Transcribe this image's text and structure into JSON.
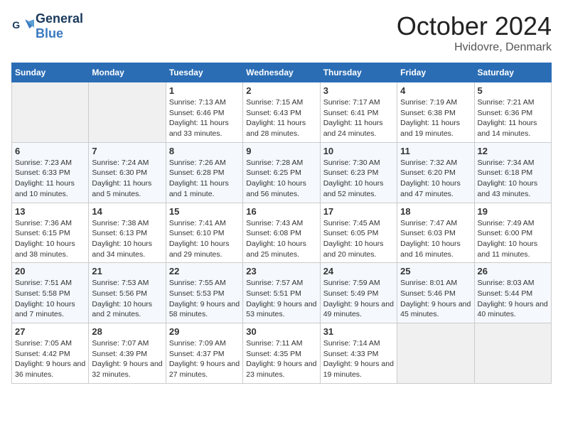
{
  "header": {
    "logo_text_general": "General",
    "logo_text_blue": "Blue",
    "month_title": "October 2024",
    "location": "Hvidovre, Denmark"
  },
  "columns": [
    "Sunday",
    "Monday",
    "Tuesday",
    "Wednesday",
    "Thursday",
    "Friday",
    "Saturday"
  ],
  "weeks": [
    [
      {
        "day": "",
        "info": ""
      },
      {
        "day": "",
        "info": ""
      },
      {
        "day": "1",
        "sunrise": "7:13 AM",
        "sunset": "6:46 PM",
        "daylight": "11 hours and 33 minutes."
      },
      {
        "day": "2",
        "sunrise": "7:15 AM",
        "sunset": "6:43 PM",
        "daylight": "11 hours and 28 minutes."
      },
      {
        "day": "3",
        "sunrise": "7:17 AM",
        "sunset": "6:41 PM",
        "daylight": "11 hours and 24 minutes."
      },
      {
        "day": "4",
        "sunrise": "7:19 AM",
        "sunset": "6:38 PM",
        "daylight": "11 hours and 19 minutes."
      },
      {
        "day": "5",
        "sunrise": "7:21 AM",
        "sunset": "6:36 PM",
        "daylight": "11 hours and 14 minutes."
      }
    ],
    [
      {
        "day": "6",
        "sunrise": "7:23 AM",
        "sunset": "6:33 PM",
        "daylight": "11 hours and 10 minutes."
      },
      {
        "day": "7",
        "sunrise": "7:24 AM",
        "sunset": "6:30 PM",
        "daylight": "11 hours and 5 minutes."
      },
      {
        "day": "8",
        "sunrise": "7:26 AM",
        "sunset": "6:28 PM",
        "daylight": "11 hours and 1 minute."
      },
      {
        "day": "9",
        "sunrise": "7:28 AM",
        "sunset": "6:25 PM",
        "daylight": "10 hours and 56 minutes."
      },
      {
        "day": "10",
        "sunrise": "7:30 AM",
        "sunset": "6:23 PM",
        "daylight": "10 hours and 52 minutes."
      },
      {
        "day": "11",
        "sunrise": "7:32 AM",
        "sunset": "6:20 PM",
        "daylight": "10 hours and 47 minutes."
      },
      {
        "day": "12",
        "sunrise": "7:34 AM",
        "sunset": "6:18 PM",
        "daylight": "10 hours and 43 minutes."
      }
    ],
    [
      {
        "day": "13",
        "sunrise": "7:36 AM",
        "sunset": "6:15 PM",
        "daylight": "10 hours and 38 minutes."
      },
      {
        "day": "14",
        "sunrise": "7:38 AM",
        "sunset": "6:13 PM",
        "daylight": "10 hours and 34 minutes."
      },
      {
        "day": "15",
        "sunrise": "7:41 AM",
        "sunset": "6:10 PM",
        "daylight": "10 hours and 29 minutes."
      },
      {
        "day": "16",
        "sunrise": "7:43 AM",
        "sunset": "6:08 PM",
        "daylight": "10 hours and 25 minutes."
      },
      {
        "day": "17",
        "sunrise": "7:45 AM",
        "sunset": "6:05 PM",
        "daylight": "10 hours and 20 minutes."
      },
      {
        "day": "18",
        "sunrise": "7:47 AM",
        "sunset": "6:03 PM",
        "daylight": "10 hours and 16 minutes."
      },
      {
        "day": "19",
        "sunrise": "7:49 AM",
        "sunset": "6:00 PM",
        "daylight": "10 hours and 11 minutes."
      }
    ],
    [
      {
        "day": "20",
        "sunrise": "7:51 AM",
        "sunset": "5:58 PM",
        "daylight": "10 hours and 7 minutes."
      },
      {
        "day": "21",
        "sunrise": "7:53 AM",
        "sunset": "5:56 PM",
        "daylight": "10 hours and 2 minutes."
      },
      {
        "day": "22",
        "sunrise": "7:55 AM",
        "sunset": "5:53 PM",
        "daylight": "9 hours and 58 minutes."
      },
      {
        "day": "23",
        "sunrise": "7:57 AM",
        "sunset": "5:51 PM",
        "daylight": "9 hours and 53 minutes."
      },
      {
        "day": "24",
        "sunrise": "7:59 AM",
        "sunset": "5:49 PM",
        "daylight": "9 hours and 49 minutes."
      },
      {
        "day": "25",
        "sunrise": "8:01 AM",
        "sunset": "5:46 PM",
        "daylight": "9 hours and 45 minutes."
      },
      {
        "day": "26",
        "sunrise": "8:03 AM",
        "sunset": "5:44 PM",
        "daylight": "9 hours and 40 minutes."
      }
    ],
    [
      {
        "day": "27",
        "sunrise": "7:05 AM",
        "sunset": "4:42 PM",
        "daylight": "9 hours and 36 minutes."
      },
      {
        "day": "28",
        "sunrise": "7:07 AM",
        "sunset": "4:39 PM",
        "daylight": "9 hours and 32 minutes."
      },
      {
        "day": "29",
        "sunrise": "7:09 AM",
        "sunset": "4:37 PM",
        "daylight": "9 hours and 27 minutes."
      },
      {
        "day": "30",
        "sunrise": "7:11 AM",
        "sunset": "4:35 PM",
        "daylight": "9 hours and 23 minutes."
      },
      {
        "day": "31",
        "sunrise": "7:14 AM",
        "sunset": "4:33 PM",
        "daylight": "9 hours and 19 minutes."
      },
      {
        "day": "",
        "info": ""
      },
      {
        "day": "",
        "info": ""
      }
    ]
  ]
}
